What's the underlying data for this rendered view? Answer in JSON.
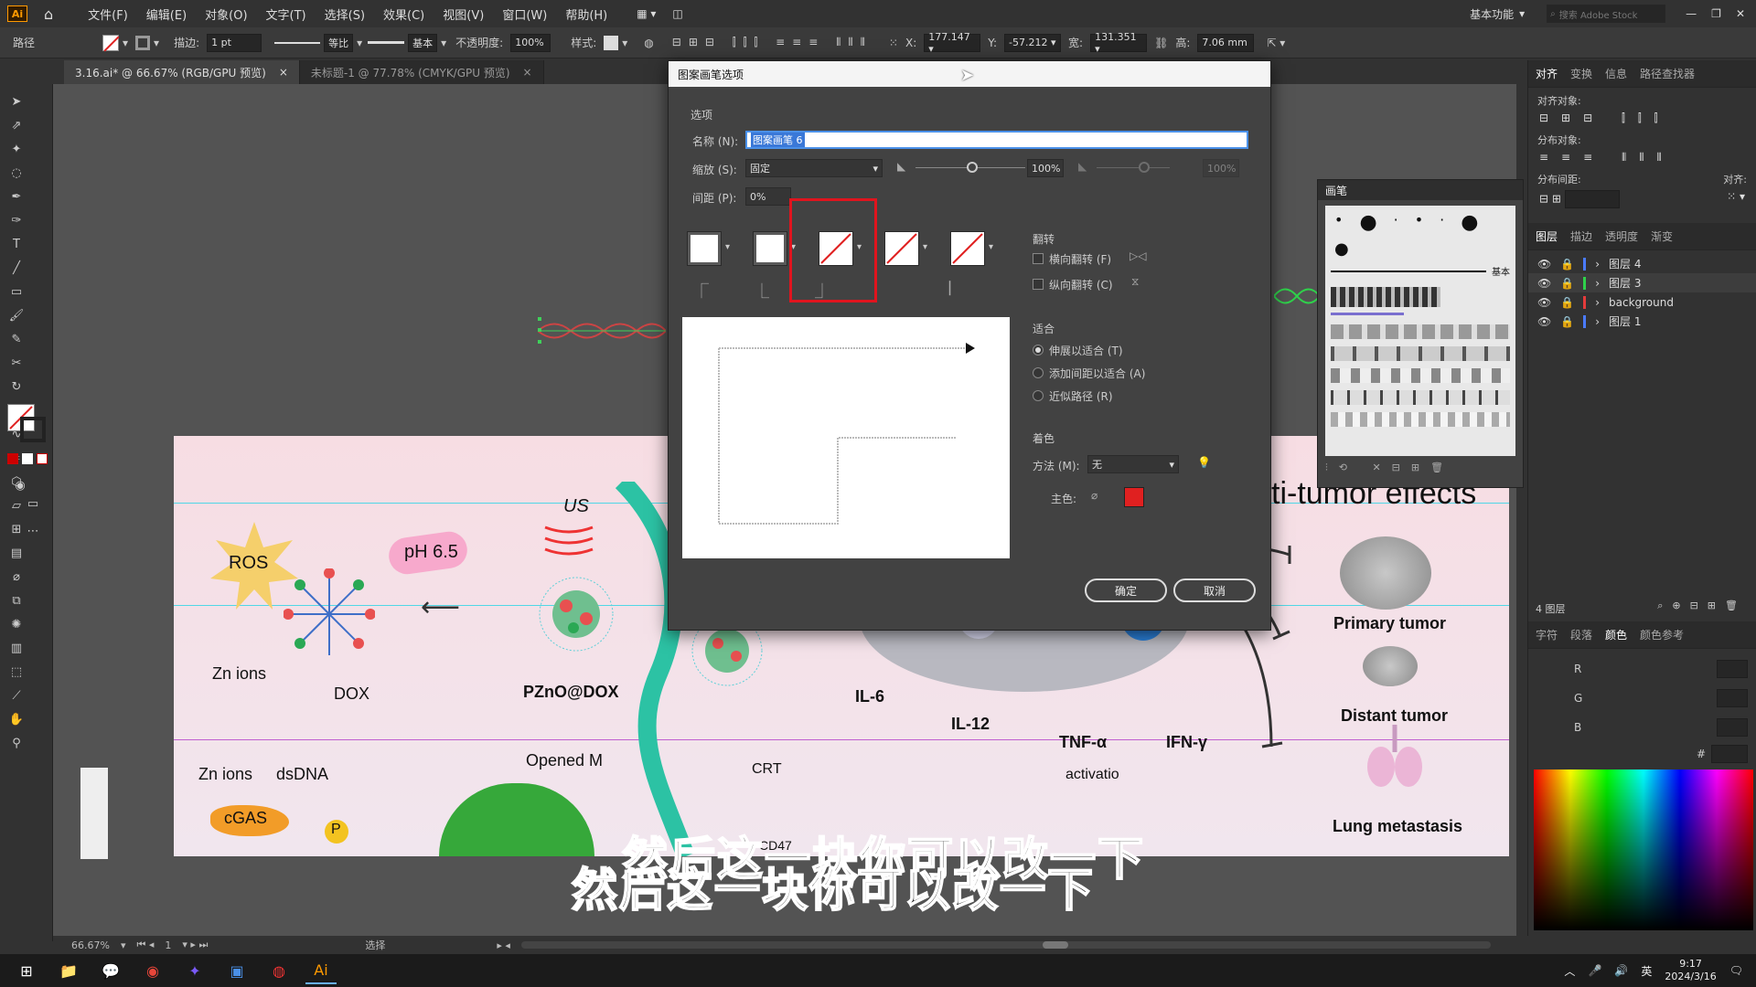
{
  "app": {
    "logo": "Ai",
    "workspace_label": "基本功能",
    "stock_search_placeholder": "搜索 Adobe Stock"
  },
  "menus": [
    "文件(F)",
    "编辑(E)",
    "对象(O)",
    "文字(T)",
    "选择(S)",
    "效果(C)",
    "视图(V)",
    "窗口(W)",
    "帮助(H)"
  ],
  "control_bar": {
    "selection_label": "路径",
    "stroke_label": "描边:",
    "stroke_value": "1 pt",
    "profile_label": "等比",
    "brush_label": "基本",
    "opacity_label": "不透明度:",
    "opacity_value": "100%",
    "style_label": "样式:",
    "x_label": "X:",
    "x_value": "177.147 ▾",
    "y_label": "Y:",
    "y_value": "-57.212 ▾",
    "w_label": "宽:",
    "w_value": "131.351 ▾",
    "h_label": "高:",
    "h_value": "7.06 mm"
  },
  "doc_tabs": [
    {
      "label": "3.16.ai* @ 66.67% (RGB/GPU 预览)",
      "active": true
    },
    {
      "label": "未标题-1 @ 77.78% (CMYK/GPU 预览)",
      "active": false
    }
  ],
  "status_bar": {
    "zoom": "66.67%",
    "page": "1",
    "tool": "选择"
  },
  "dialog": {
    "title": "图案画笔选项",
    "section_options": "选项",
    "name_label": "名称 (N):",
    "name_value": "图案画笔 6",
    "scale_label": "缩放 (S):",
    "scale_value": "固定",
    "scale_percent": "100%",
    "scale_percent2": "100%",
    "spacing_label": "间距 (P):",
    "spacing_value": "0%",
    "flip_title": "翻转",
    "flip_h": "横向翻转 (F)",
    "flip_v": "纵向翻转 (C)",
    "fit_title": "适合",
    "fit_options": [
      "伸展以适合 (T)",
      "添加间距以适合 (A)",
      "近似路径 (R)"
    ],
    "color_title": "着色",
    "method_label": "方法 (M):",
    "method_value": "无",
    "key_color_label": "主色:",
    "key_color": "#e02020",
    "ok": "确定",
    "cancel": "取消",
    "highlight_color": "#e0141e"
  },
  "brushes_panel": {
    "title": "画笔",
    "basic_label": "基本"
  },
  "right_panel": {
    "top_tabs": [
      "对齐",
      "变换",
      "信息",
      "路径查找器"
    ],
    "align_objects": "对齐对象:",
    "distribute_objects": "分布对象:",
    "distribute_spacing": "分布间距:",
    "align_to": "对齐:",
    "layer_tabs": [
      "图层",
      "描边",
      "透明度",
      "渐变"
    ],
    "layers": [
      {
        "name": "图层 4",
        "color": "#4a7bff"
      },
      {
        "name": "图层 3",
        "color": "#2fd14b"
      },
      {
        "name": "background",
        "color": "#e33b3b"
      },
      {
        "name": "图层 1",
        "color": "#4a7bff"
      }
    ],
    "layer_count": "4 图层",
    "color_tabs": [
      "字符",
      "段落",
      "颜色",
      "颜色参考"
    ],
    "rgb_labels": [
      "R",
      "G",
      "B"
    ],
    "hash": "#"
  },
  "artboard": {
    "title_partial": "ti-tumor effects",
    "labels": [
      "ROS",
      "pH 6.5",
      "US",
      "Zn ions",
      "DOX",
      "PZnO@DOX",
      "Zn ions",
      "dsDNA",
      "Opened M",
      "cGAS",
      "P",
      "CRT",
      "CD47",
      "IL-6",
      "IL-12",
      "TNF-α",
      "IFN-γ",
      "activatio",
      "Primary tumor",
      "Distant tumor",
      "Lung metastasis"
    ]
  },
  "subtitle": "然后这一块你可以改一下",
  "taskbar": {
    "time": "9:17",
    "date": "2024/3/16",
    "ime": "英"
  }
}
